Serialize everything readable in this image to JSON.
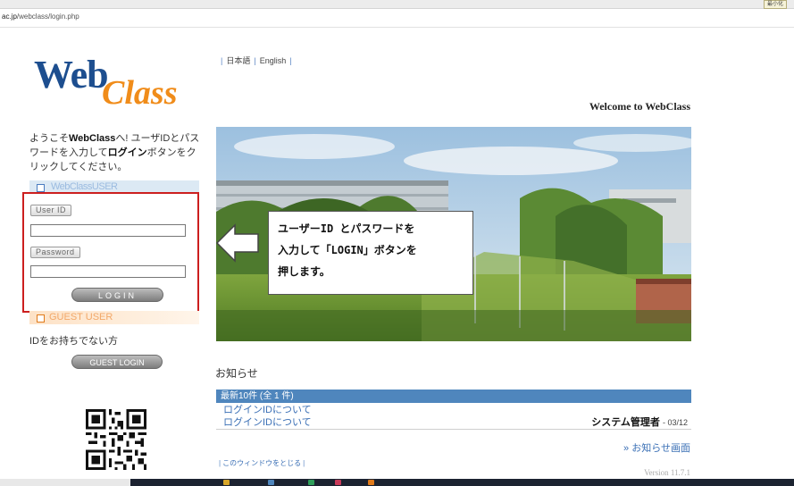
{
  "browser": {
    "url_host": "ac.jp",
    "url_path": "/webclass/login.php",
    "mini_button": "最小化"
  },
  "logo": {
    "web": "Web",
    "class": "Class"
  },
  "sidebar": {
    "intro_pre": "ようこそ",
    "intro_brand": "WebClass",
    "intro_mid": "へ! ユーザIDとパスワードを入力して",
    "intro_btn": "ログイン",
    "intro_post": "ボタンをクリックしてください。",
    "webclass_user_header": "WebClassUSER",
    "user_id_label": "User ID",
    "user_id_value": "",
    "password_label": "Password",
    "password_value": "",
    "login_button": "LOGIN",
    "guest_header": "GUEST USER",
    "guest_note": "IDをお持ちでない方",
    "guest_login_button": "GUEST LOGIN"
  },
  "language": {
    "japanese": "日本語",
    "english": "English"
  },
  "welcome": "Welcome to WebClass",
  "callout": {
    "line1": "ユーザーID とパスワードを",
    "line2": "入力して「LOGIN」ボタンを",
    "line3": "押します。"
  },
  "news": {
    "title": "お知らせ",
    "header": "最新10件 (全 1 件)",
    "items": [
      {
        "label": "ログインIDについて"
      },
      {
        "label": "ログインIDについて",
        "author": "システム管理者",
        "date": "- 03/12"
      }
    ],
    "more": "» お知らせ画面"
  },
  "close_window": "このウィンドウをとじる",
  "version": "Version 11.7.1",
  "colors": {
    "accent_blue": "#4f86bd",
    "highlight_red": "#cc1f1f",
    "logo_blue": "#1d4e8f",
    "logo_orange": "#f08c1a"
  }
}
